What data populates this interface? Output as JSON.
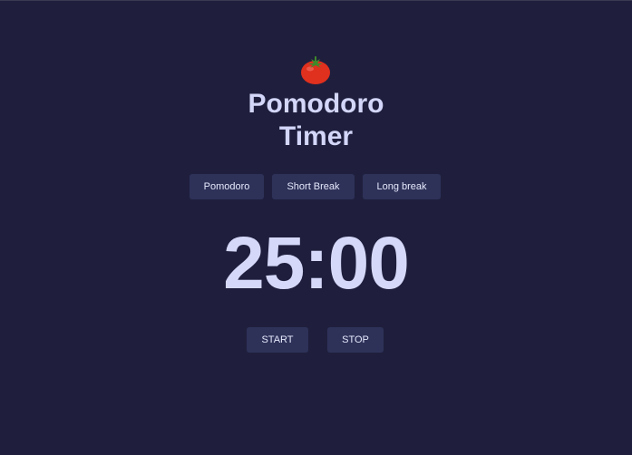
{
  "app": {
    "title_line1": "Pomodoro",
    "title_line2": "Timer",
    "logo_icon": "tomato-icon"
  },
  "tabs": [
    {
      "label": "Pomodoro"
    },
    {
      "label": "Short Break"
    },
    {
      "label": "Long break"
    }
  ],
  "timer": {
    "display": "25:00"
  },
  "controls": {
    "start_label": "START",
    "stop_label": "STOP"
  },
  "colors": {
    "background": "#1f1f3d",
    "button": "#2e3259",
    "text": "#d3d6f8",
    "tomato": "#e0301e"
  }
}
